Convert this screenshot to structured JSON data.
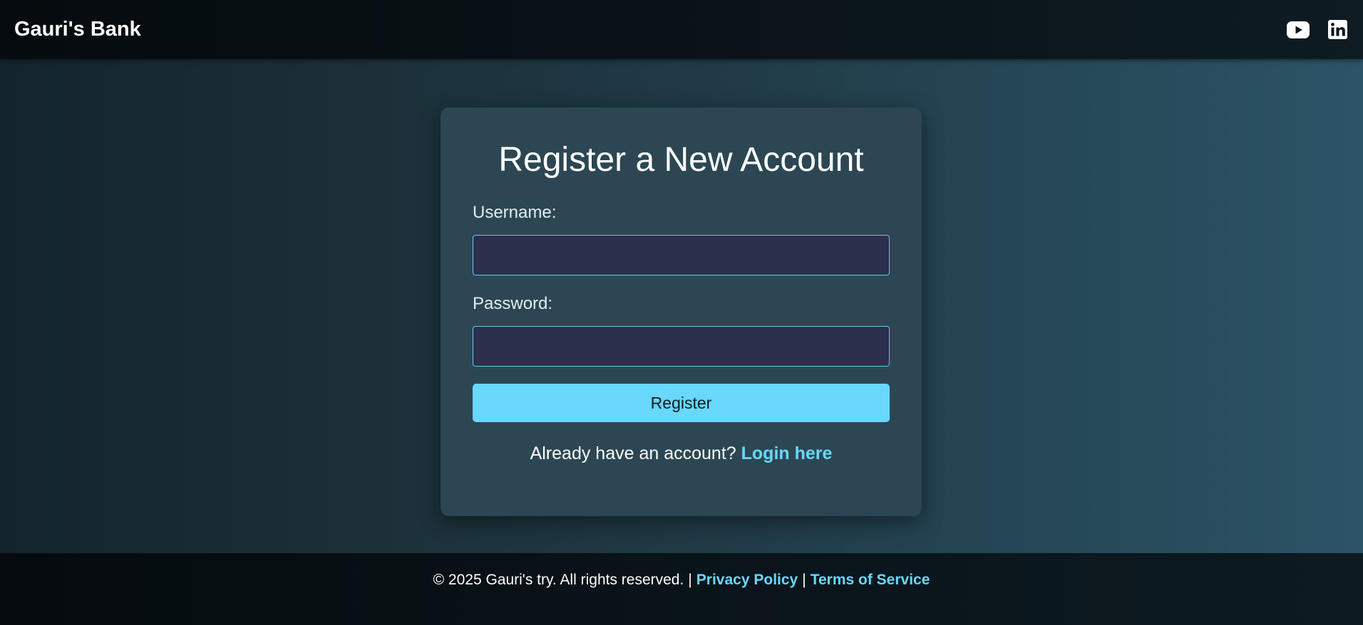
{
  "header": {
    "brand": "Gauri's Bank",
    "social": [
      {
        "icon": "youtube-icon"
      },
      {
        "icon": "linkedin-icon"
      }
    ]
  },
  "card": {
    "title": "Register a New Account",
    "username_label": "Username:",
    "username_value": "",
    "password_label": "Password:",
    "password_value": "",
    "register_label": "Register",
    "login_prompt": "Already have an account?",
    "login_link": "Login here"
  },
  "footer": {
    "copyright": "© 2025 Gauri's try. All rights reserved.",
    "separator": "|",
    "privacy": "Privacy Policy",
    "terms": "Terms of Service"
  },
  "colors": {
    "accent": "#68d8fc",
    "card": "#2c4753",
    "input_bg": "#2b2f4c",
    "header_bg": "#070e12"
  }
}
